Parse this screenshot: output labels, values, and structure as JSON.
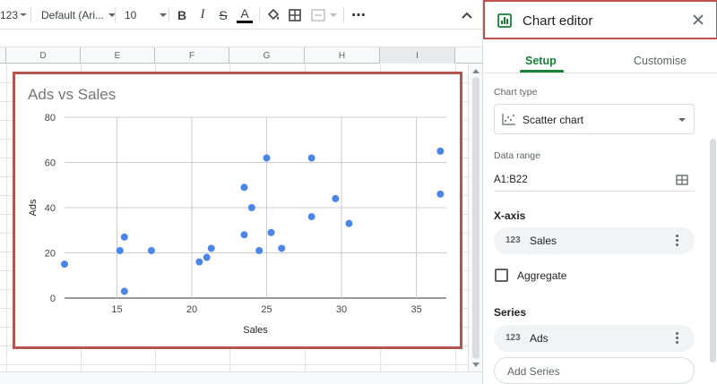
{
  "toolbar": {
    "format_label": "123",
    "font_name": "Default (Ari...",
    "font_size": "10",
    "bold_label": "B",
    "italic_label": "I",
    "strike_label": "S",
    "text_color_label": "A",
    "more_label": "⋯",
    "icons": [
      "format-icon",
      "bold-icon",
      "italic-icon",
      "strikethrough-icon",
      "text-color-icon",
      "fill-color-icon",
      "borders-icon",
      "merge-cells-icon",
      "more-icon",
      "collapse-icon"
    ]
  },
  "columns": [
    "D",
    "E",
    "F",
    "G",
    "H",
    "I"
  ],
  "selected_column": "I",
  "chart_data": {
    "type": "scatter",
    "title": "Ads vs Sales",
    "xlabel": "Sales",
    "ylabel": "Ads",
    "xlim": [
      11.5,
      37
    ],
    "ylim": [
      0,
      80
    ],
    "xticks": [
      15,
      20,
      25,
      30,
      35
    ],
    "yticks": [
      0,
      20,
      40,
      60,
      80
    ],
    "grid": true,
    "color": "#4a86e8",
    "series": [
      {
        "x": [
          11.5,
          15.2,
          15.5,
          15.5,
          17.3,
          20.5,
          21.0,
          21.3,
          23.5,
          23.5,
          24.0,
          24.5,
          25.0,
          25.3,
          26.0,
          28.0,
          28.0,
          29.6,
          30.5,
          36.6,
          36.6
        ],
        "y": [
          15,
          21,
          27,
          3,
          21,
          16,
          18,
          22,
          49,
          28,
          40,
          21,
          62,
          29,
          22,
          62,
          36,
          44,
          33,
          65,
          46
        ]
      }
    ]
  },
  "panel": {
    "title": "Chart editor",
    "tabs": [
      {
        "label": "Setup",
        "active": true
      },
      {
        "label": "Customise",
        "active": false
      }
    ],
    "chart_type_label": "Chart type",
    "chart_type_value": "Scatter chart",
    "data_range_label": "Data range",
    "data_range_value": "A1:B22",
    "x_axis_label": "X-axis",
    "x_axis_chip": {
      "num": "123",
      "text": "Sales"
    },
    "aggregate_label": "Aggregate",
    "series_label": "Series",
    "series_chip": {
      "num": "123",
      "text": "Ads"
    },
    "add_series_label": "Add Series",
    "accent_color": "#188038"
  }
}
